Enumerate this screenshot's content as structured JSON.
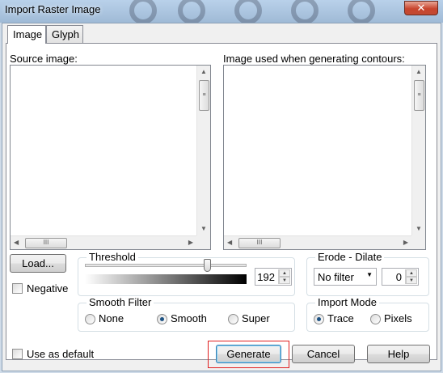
{
  "window": {
    "title": "Import Raster Image",
    "close_glyph": "✕"
  },
  "tabs": [
    {
      "label": "Image",
      "active": true
    },
    {
      "label": "Glyph",
      "active": false
    }
  ],
  "source": {
    "label": "Source image:"
  },
  "contours": {
    "label": "Image used when generating contours:"
  },
  "scroll_grip": "≡",
  "scroll_grip_h": "III",
  "load_button": "Load...",
  "negative": {
    "label": "Negative",
    "checked": false
  },
  "threshold": {
    "label": "Threshold",
    "value": "192",
    "level": 192,
    "max": 255
  },
  "erode": {
    "label": "Erode - Dilate",
    "filter": "No filter",
    "value": "0"
  },
  "smooth": {
    "label": "Smooth Filter",
    "options": [
      "None",
      "Smooth",
      "Super"
    ],
    "selected": "Smooth"
  },
  "import_mode": {
    "label": "Import Mode",
    "options": [
      "Trace",
      "Pixels"
    ],
    "selected": "Trace"
  },
  "use_default": {
    "label": "Use as default",
    "checked": false
  },
  "buttons": {
    "generate": "Generate",
    "cancel": "Cancel",
    "help": "Help"
  },
  "colors": {
    "highlight": "#e02020",
    "radio_dot": "#1d5283"
  }
}
